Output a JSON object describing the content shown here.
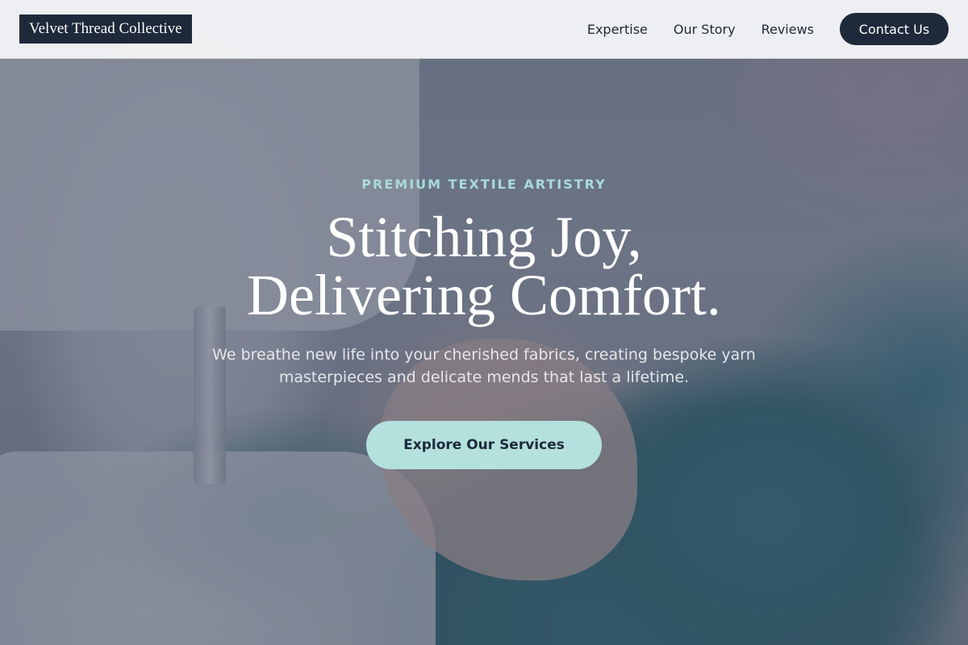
{
  "header": {
    "logo_text": "Velvet Thread Collective",
    "nav": [
      {
        "label": "Expertise"
      },
      {
        "label": "Our Story"
      },
      {
        "label": "Reviews"
      }
    ],
    "contact_label": "Contact Us"
  },
  "hero": {
    "eyebrow": "PREMIUM TEXTILE ARTISTRY",
    "headline_line1": "Stitching Joy,",
    "headline_line2": "Delivering Comfort.",
    "subtext": "We breathe new life into your cherished fabrics, creating bespoke yarn masterpieces and delicate mends that last a lifetime.",
    "cta_label": "Explore Our Services",
    "background_image": "sewing-machine-hands-teal-fabric"
  },
  "colors": {
    "navy": "#1e293b",
    "accent_teal": "#b4e0dd",
    "eyebrow_teal": "#a8dcd9"
  }
}
